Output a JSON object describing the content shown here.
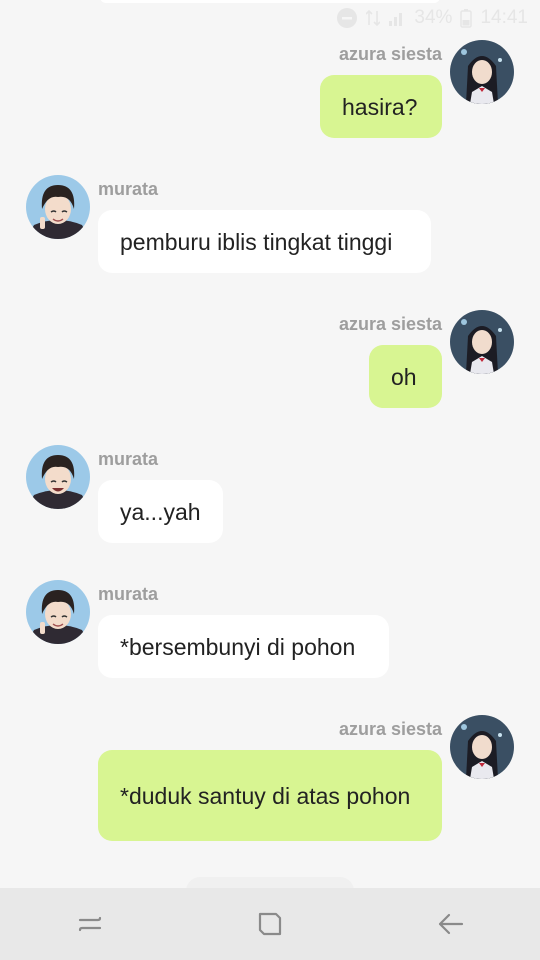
{
  "status": {
    "battery": "34%",
    "time": "14:41"
  },
  "messages": [
    {
      "sender": "azura siesta",
      "side": "me",
      "text": "hasira?"
    },
    {
      "sender": "murata",
      "side": "them",
      "text": "pemburu iblis tingkat tinggi"
    },
    {
      "sender": "azura siesta",
      "side": "me",
      "text": "oh"
    },
    {
      "sender": "murata",
      "side": "them",
      "text": "ya...yah"
    },
    {
      "sender": "murata",
      "side": "them",
      "text": "*bersembunyi di pohon"
    },
    {
      "sender": "azura siesta",
      "side": "me",
      "text": "*duduk santuy di atas pohon"
    }
  ],
  "colors": {
    "my_bubble": "#d8f592",
    "their_bubble": "#ffffff",
    "background": "#f6f6f6",
    "sender_name": "#9e9e9e"
  },
  "icons": {
    "nav_recent": "recent-apps-icon",
    "nav_home": "home-icon",
    "nav_back": "back-icon"
  }
}
